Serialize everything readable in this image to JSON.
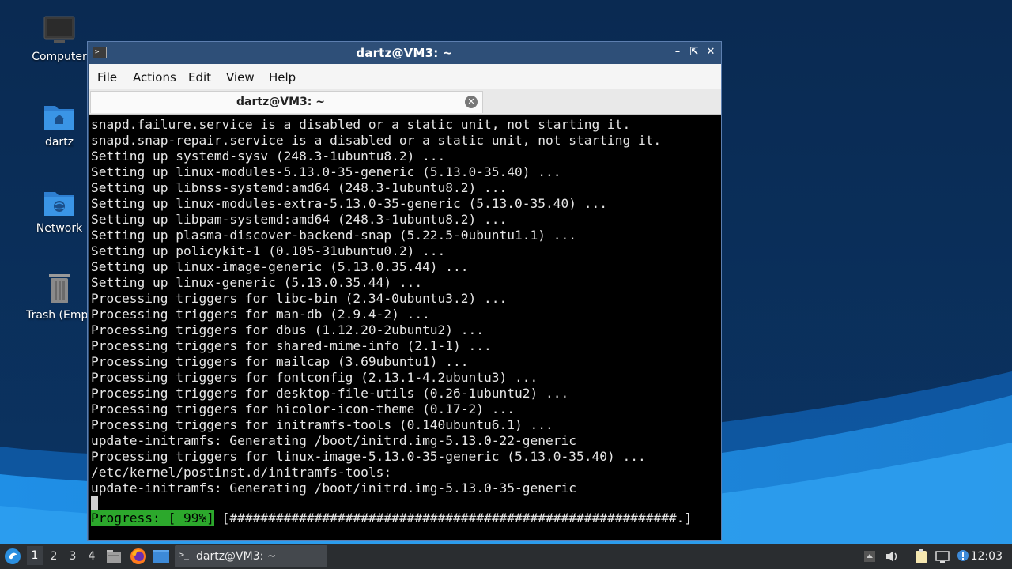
{
  "desktop": {
    "icons": [
      {
        "label": "Computer"
      },
      {
        "label": "dartz"
      },
      {
        "label": "Network"
      },
      {
        "label": "Trash (Empt"
      }
    ]
  },
  "window": {
    "title": "dartz@VM3: ~",
    "menu": [
      "File",
      "Actions",
      "Edit",
      "View",
      "Help"
    ],
    "tab_title": "dartz@VM3: ~",
    "terminal_lines": [
      "snapd.failure.service is a disabled or a static unit, not starting it.",
      "snapd.snap-repair.service is a disabled or a static unit, not starting it.",
      "Setting up systemd-sysv (248.3-1ubuntu8.2) ...",
      "Setting up linux-modules-5.13.0-35-generic (5.13.0-35.40) ...",
      "Setting up libnss-systemd:amd64 (248.3-1ubuntu8.2) ...",
      "Setting up linux-modules-extra-5.13.0-35-generic (5.13.0-35.40) ...",
      "Setting up libpam-systemd:amd64 (248.3-1ubuntu8.2) ...",
      "Setting up plasma-discover-backend-snap (5.22.5-0ubuntu1.1) ...",
      "Setting up policykit-1 (0.105-31ubuntu0.2) ...",
      "Setting up linux-image-generic (5.13.0.35.44) ...",
      "Setting up linux-generic (5.13.0.35.44) ...",
      "Processing triggers for libc-bin (2.34-0ubuntu3.2) ...",
      "Processing triggers for man-db (2.9.4-2) ...",
      "Processing triggers for dbus (1.12.20-2ubuntu2) ...",
      "Processing triggers for shared-mime-info (2.1-1) ...",
      "Processing triggers for mailcap (3.69ubuntu1) ...",
      "Processing triggers for fontconfig (2.13.1-4.2ubuntu3) ...",
      "Processing triggers for desktop-file-utils (0.26-1ubuntu2) ...",
      "Processing triggers for hicolor-icon-theme (0.17-2) ...",
      "Processing triggers for initramfs-tools (0.140ubuntu6.1) ...",
      "update-initramfs: Generating /boot/initrd.img-5.13.0-22-generic",
      "Processing triggers for linux-image-5.13.0-35-generic (5.13.0-35.40) ...",
      "/etc/kernel/postinst.d/initramfs-tools:",
      "update-initramfs: Generating /boot/initrd.img-5.13.0-35-generic"
    ],
    "progress_label": "Progress: [ 99%]",
    "progress_bar": " [##########################################################.]"
  },
  "taskbar": {
    "workspaces": [
      "1",
      "2",
      "3",
      "4"
    ],
    "task_label": "dartz@VM3: ~",
    "clock": "12:03"
  },
  "colors": {
    "wallpaper_dark": "#0b2d55",
    "wallpaper_light": "#1d8fe0",
    "titlebar": "#2e4f78",
    "progress_green": "#2ca82c"
  }
}
